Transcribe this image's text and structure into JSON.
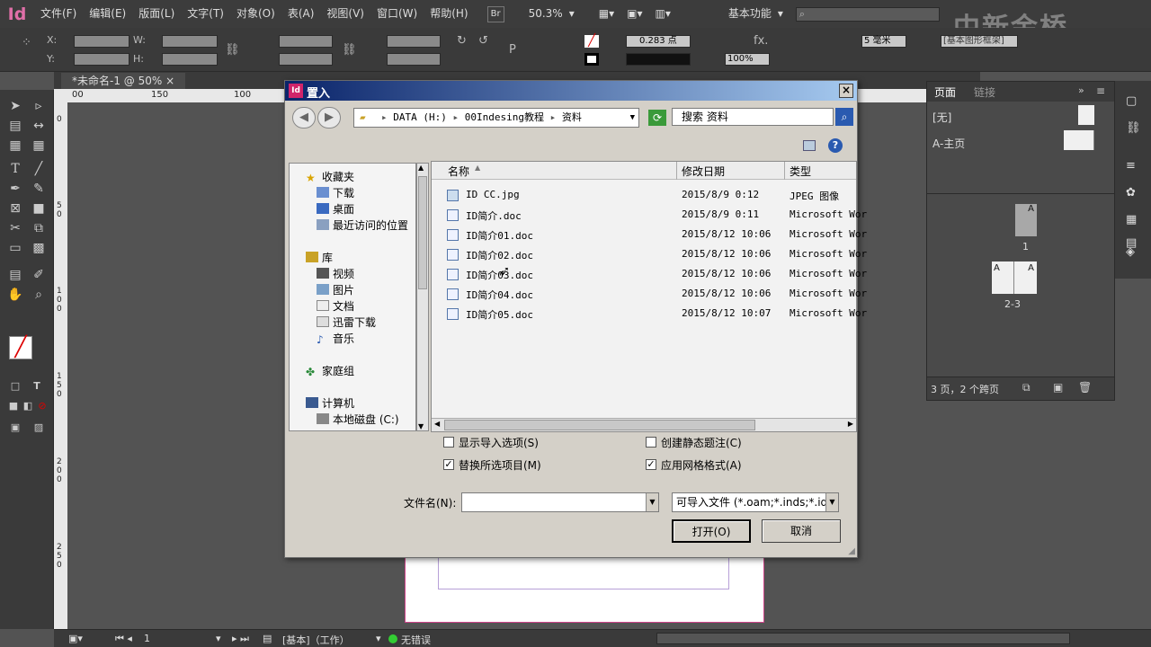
{
  "app": {
    "logo": "Id",
    "zoom": "50.3%",
    "workspace": "基本功能",
    "bridge": "Br"
  },
  "menu": [
    "文件(F)",
    "编辑(E)",
    "版面(L)",
    "文字(T)",
    "对象(O)",
    "表(A)",
    "视图(V)",
    "窗口(W)",
    "帮助(H)"
  ],
  "control": {
    "x_label": "X:",
    "y_label": "Y:",
    "w_label": "W:",
    "h_label": "H:",
    "stroke_weight": "0.283 点",
    "opacity": "100%",
    "gutter": "5 毫米",
    "style": "[基本图形框架]"
  },
  "doc_tab": "*未命名-1 @ 50%",
  "ruler": {
    "h": [
      "00",
      "150",
      "100"
    ],
    "v": [
      "0",
      "5 0",
      "1 0 0",
      "1 5 0",
      "2 0 0",
      "2 5 0"
    ]
  },
  "pages_panel": {
    "tab_pages": "页面",
    "tab_links": "链接",
    "none_master": "[无]",
    "a_master": "A-主页",
    "page1": "1",
    "spread": "2-3",
    "page_letter": "A",
    "footer": "3 页，2 个跨页"
  },
  "status": {
    "page": "1",
    "mode": "[基本]（工作）",
    "errors": "无错误"
  },
  "dialog": {
    "title": "置入",
    "close": "×",
    "address": [
      "DATA (H:)",
      "00Indesing教程",
      "资料"
    ],
    "search_placeholder": "搜索 资料",
    "nav": {
      "favorites": "收藏夹",
      "downloads": "下载",
      "desktop": "桌面",
      "recent": "最近访问的位置",
      "library": "库",
      "videos": "视频",
      "pictures": "图片",
      "documents": "文档",
      "xunlei": "迅雷下载",
      "music": "音乐",
      "homegroup": "家庭组",
      "computer": "计算机",
      "local_disk": "本地磁盘 (C:)"
    },
    "columns": {
      "name": "名称",
      "date": "修改日期",
      "type": "类型"
    },
    "files": [
      {
        "name": "ID CC.jpg",
        "date": "2015/8/9 0:12",
        "type": "JPEG 图像"
      },
      {
        "name": "ID简介.doc",
        "date": "2015/8/9 0:11",
        "type": "Microsoft Wor"
      },
      {
        "name": "ID简介01.doc",
        "date": "2015/8/12 10:06",
        "type": "Microsoft Wor"
      },
      {
        "name": "ID简介02.doc",
        "date": "2015/8/12 10:06",
        "type": "Microsoft Wor"
      },
      {
        "name": "ID简介03.doc",
        "date": "2015/8/12 10:06",
        "type": "Microsoft Wor"
      },
      {
        "name": "ID简介04.doc",
        "date": "2015/8/12 10:06",
        "type": "Microsoft Wor"
      },
      {
        "name": "ID简介05.doc",
        "date": "2015/8/12 10:07",
        "type": "Microsoft Wor"
      }
    ],
    "options": {
      "show_import": "显示导入选项(S)",
      "replace": "替换所选项目(M)",
      "static_caption": "创建静态题注(C)",
      "grid_format": "应用网格格式(A)"
    },
    "filename_label": "文件名(N):",
    "filetype": "可导入文件 (*.oam;*.inds;*.idn",
    "open": "打开(O)",
    "cancel": "取消"
  },
  "watermark": "中新金桥"
}
